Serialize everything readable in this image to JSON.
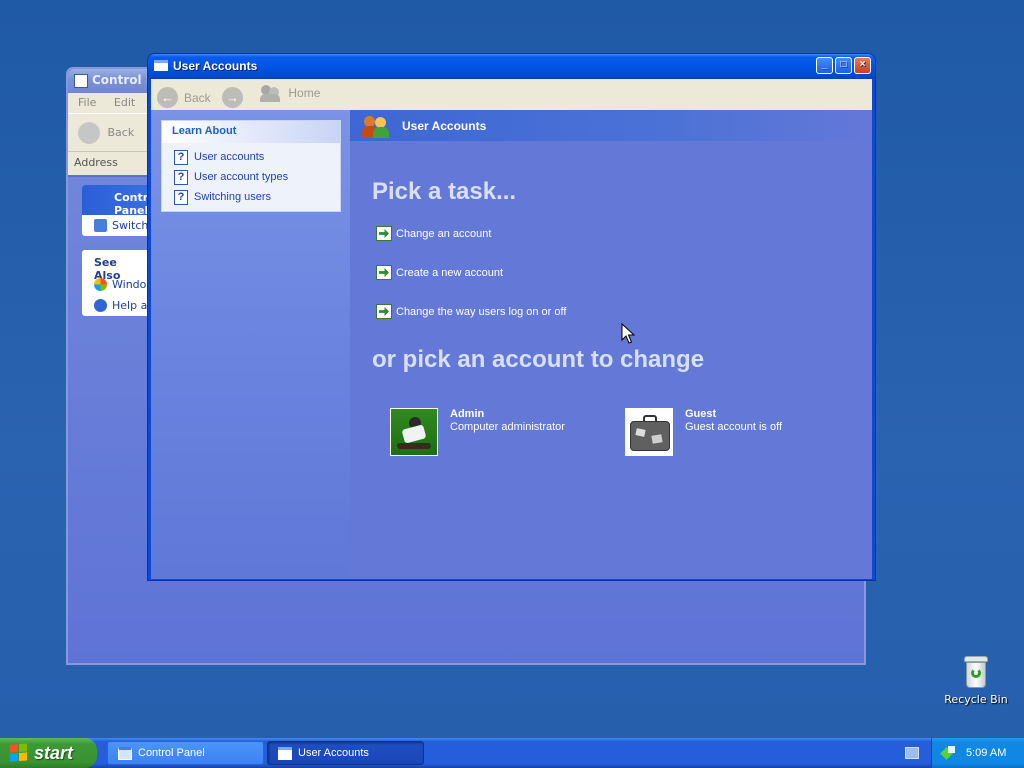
{
  "desktop": {
    "recycle_bin_label": "Recycle Bin"
  },
  "control_panel_window": {
    "title": "Control Panel",
    "menu": [
      "File",
      "Edit"
    ],
    "back_label": "Back",
    "address_label": "Address",
    "tasks_header": "Control Panel",
    "tasks_item": "Switch",
    "see_also_header": "See Also",
    "see_also_items": [
      "Windows",
      "Help and"
    ]
  },
  "user_accounts_window": {
    "title": "User Accounts",
    "nav": {
      "back_label": "Back",
      "home_label": "Home"
    },
    "learn_about": {
      "header": "Learn About",
      "items": [
        "User accounts",
        "User account types",
        "Switching users"
      ]
    },
    "header_title": "User Accounts",
    "pick_task_heading": "Pick a task...",
    "tasks": [
      "Change an account",
      "Create a new account",
      "Change the way users log on or off"
    ],
    "pick_account_heading": "or pick an account to change",
    "accounts": [
      {
        "name": "Admin",
        "description": "Computer administrator",
        "picture": "skateboarder"
      },
      {
        "name": "Guest",
        "description": "Guest account is off",
        "picture": "suitcase"
      }
    ]
  },
  "taskbar": {
    "start_label": "start",
    "buttons": [
      "Control Panel",
      "User Accounts"
    ],
    "active_button": "User Accounts",
    "clock": "5:09 AM"
  },
  "colors": {
    "desktop": "#245ea9",
    "titlebar_active": "#0054e3",
    "content_bg": "#6478d8",
    "start_green": "#3c9a36",
    "tray_blue": "#0f87e3"
  }
}
